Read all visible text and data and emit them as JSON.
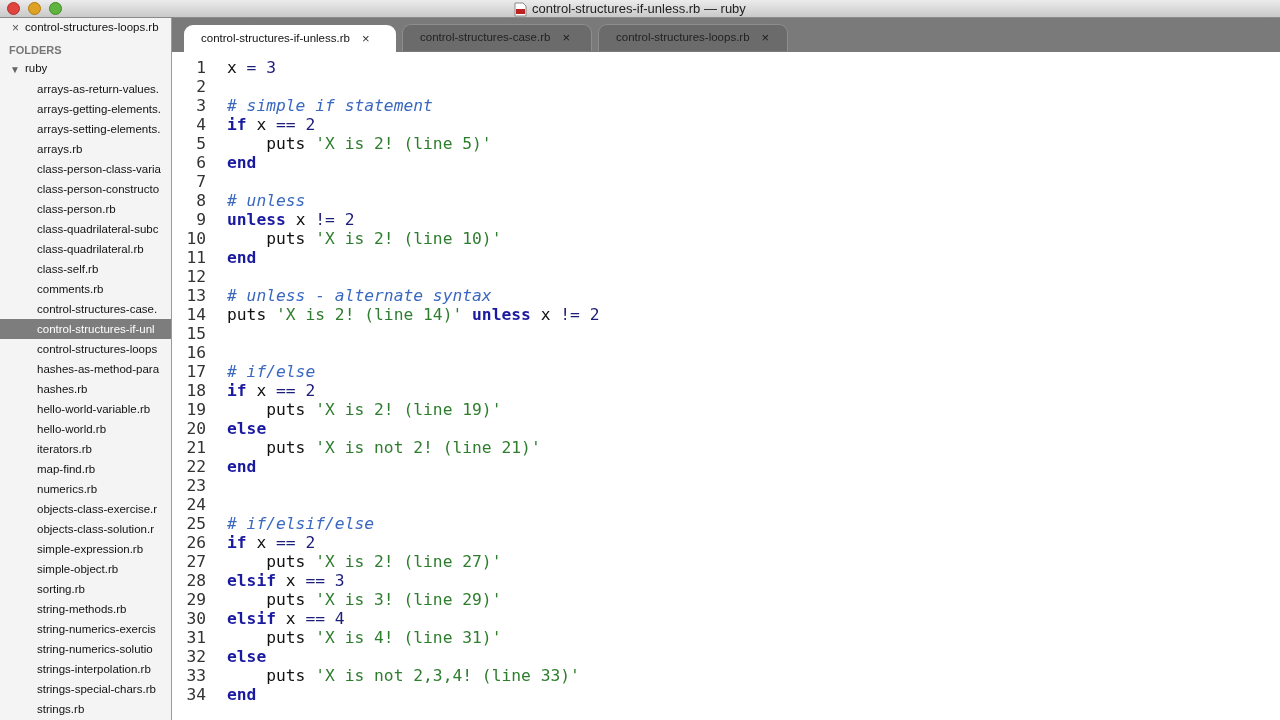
{
  "window": {
    "title": "control-structures-if-unless.rb — ruby"
  },
  "sidebar": {
    "open_files": [
      {
        "name": "control-structures-loops.rb",
        "close": "×"
      }
    ],
    "folders_heading": "FOLDERS",
    "folder": {
      "toggle": "▼",
      "name": "ruby",
      "expanded": true,
      "children": [
        {
          "name": "arrays-as-return-values.",
          "selected": false
        },
        {
          "name": "arrays-getting-elements.",
          "selected": false
        },
        {
          "name": "arrays-setting-elements.",
          "selected": false
        },
        {
          "name": "arrays.rb",
          "selected": false
        },
        {
          "name": "class-person-class-varia",
          "selected": false
        },
        {
          "name": "class-person-constructo",
          "selected": false
        },
        {
          "name": "class-person.rb",
          "selected": false
        },
        {
          "name": "class-quadrilateral-subc",
          "selected": false
        },
        {
          "name": "class-quadrilateral.rb",
          "selected": false
        },
        {
          "name": "class-self.rb",
          "selected": false
        },
        {
          "name": "comments.rb",
          "selected": false
        },
        {
          "name": "control-structures-case.",
          "selected": false
        },
        {
          "name": "control-structures-if-unl",
          "selected": true
        },
        {
          "name": "control-structures-loops",
          "selected": false
        },
        {
          "name": "hashes-as-method-para",
          "selected": false
        },
        {
          "name": "hashes.rb",
          "selected": false
        },
        {
          "name": "hello-world-variable.rb",
          "selected": false
        },
        {
          "name": "hello-world.rb",
          "selected": false
        },
        {
          "name": "iterators.rb",
          "selected": false
        },
        {
          "name": "map-find.rb",
          "selected": false
        },
        {
          "name": "numerics.rb",
          "selected": false
        },
        {
          "name": "objects-class-exercise.r",
          "selected": false
        },
        {
          "name": "objects-class-solution.r",
          "selected": false
        },
        {
          "name": "simple-expression.rb",
          "selected": false
        },
        {
          "name": "simple-object.rb",
          "selected": false
        },
        {
          "name": "sorting.rb",
          "selected": false
        },
        {
          "name": "string-methods.rb",
          "selected": false
        },
        {
          "name": "string-numerics-exercis",
          "selected": false
        },
        {
          "name": "string-numerics-solutio",
          "selected": false
        },
        {
          "name": "strings-interpolation.rb",
          "selected": false
        },
        {
          "name": "strings-special-chars.rb",
          "selected": false
        },
        {
          "name": "strings.rb",
          "selected": false
        }
      ]
    }
  },
  "tabs": [
    {
      "label": "control-structures-if-unless.rb",
      "close": "×",
      "selected": true
    },
    {
      "label": "control-structures-case.rb",
      "close": "×",
      "selected": false
    },
    {
      "label": "control-structures-loops.rb",
      "close": "×",
      "selected": false
    }
  ],
  "editor": {
    "lines": [
      {
        "number": "1",
        "tokens": [
          {
            "kind": "plain",
            "text": "x "
          },
          {
            "kind": "op",
            "text": "= 3"
          }
        ]
      },
      {
        "number": "2"
      },
      {
        "number": "3",
        "tokens": [
          {
            "kind": "comment",
            "text": "# simple if statement"
          }
        ]
      },
      {
        "number": "4",
        "tokens": [
          {
            "kind": "keyword",
            "text": "if"
          },
          {
            "kind": "plain",
            "text": " x "
          },
          {
            "kind": "op",
            "text": "== 2"
          }
        ]
      },
      {
        "number": "5",
        "tokens": [
          {
            "kind": "plain",
            "text": "    puts "
          },
          {
            "kind": "string",
            "text": "'X is 2! (line 5)'"
          }
        ]
      },
      {
        "number": "6",
        "tokens": [
          {
            "kind": "keyword",
            "text": "end"
          }
        ]
      },
      {
        "number": "7"
      },
      {
        "number": "8",
        "tokens": [
          {
            "kind": "comment",
            "text": "# unless"
          }
        ]
      },
      {
        "number": "9",
        "tokens": [
          {
            "kind": "keyword",
            "text": "unless"
          },
          {
            "kind": "plain",
            "text": " x "
          },
          {
            "kind": "op",
            "text": "!= 2"
          }
        ]
      },
      {
        "number": "10",
        "tokens": [
          {
            "kind": "plain",
            "text": "    puts "
          },
          {
            "kind": "string",
            "text": "'X is 2! (line 10)'"
          }
        ]
      },
      {
        "number": "11",
        "tokens": [
          {
            "kind": "keyword",
            "text": "end"
          }
        ]
      },
      {
        "number": "12"
      },
      {
        "number": "13",
        "tokens": [
          {
            "kind": "comment",
            "text": "# unless - alternate syntax"
          }
        ]
      },
      {
        "number": "14",
        "tokens": [
          {
            "kind": "plain",
            "text": "puts "
          },
          {
            "kind": "string",
            "text": "'X is 2! (line 14)'"
          },
          {
            "kind": "keyword",
            "text": " unless"
          },
          {
            "kind": "plain",
            "text": " x "
          },
          {
            "kind": "op",
            "text": "!= 2"
          }
        ]
      },
      {
        "number": "15"
      },
      {
        "number": "16"
      },
      {
        "number": "17",
        "tokens": [
          {
            "kind": "comment",
            "text": "# if/else"
          }
        ]
      },
      {
        "number": "18",
        "tokens": [
          {
            "kind": "keyword",
            "text": "if"
          },
          {
            "kind": "plain",
            "text": " x "
          },
          {
            "kind": "op",
            "text": "== 2"
          }
        ]
      },
      {
        "number": "19",
        "tokens": [
          {
            "kind": "plain",
            "text": "    puts "
          },
          {
            "kind": "string",
            "text": "'X is 2! (line 19)'"
          }
        ]
      },
      {
        "number": "20",
        "tokens": [
          {
            "kind": "keyword",
            "text": "else"
          }
        ]
      },
      {
        "number": "21",
        "tokens": [
          {
            "kind": "plain",
            "text": "    puts "
          },
          {
            "kind": "string",
            "text": "'X is not 2! (line 21)'"
          }
        ]
      },
      {
        "number": "22",
        "tokens": [
          {
            "kind": "keyword",
            "text": "end"
          }
        ]
      },
      {
        "number": "23"
      },
      {
        "number": "24"
      },
      {
        "number": "25",
        "tokens": [
          {
            "kind": "comment",
            "text": "# if/elsif/else"
          }
        ]
      },
      {
        "number": "26",
        "tokens": [
          {
            "kind": "keyword",
            "text": "if"
          },
          {
            "kind": "plain",
            "text": " x "
          },
          {
            "kind": "op",
            "text": "== 2"
          }
        ]
      },
      {
        "number": "27",
        "tokens": [
          {
            "kind": "plain",
            "text": "    puts "
          },
          {
            "kind": "string",
            "text": "'X is 2! (line 27)'"
          }
        ]
      },
      {
        "number": "28",
        "tokens": [
          {
            "kind": "keyword",
            "text": "elsif"
          },
          {
            "kind": "plain",
            "text": " x "
          },
          {
            "kind": "op",
            "text": "== 3"
          }
        ]
      },
      {
        "number": "29",
        "tokens": [
          {
            "kind": "plain",
            "text": "    puts "
          },
          {
            "kind": "string",
            "text": "'X is 3! (line 29)'"
          }
        ]
      },
      {
        "number": "30",
        "tokens": [
          {
            "kind": "keyword",
            "text": "elsif"
          },
          {
            "kind": "plain",
            "text": " x "
          },
          {
            "kind": "op",
            "text": "== 4"
          }
        ]
      },
      {
        "number": "31",
        "tokens": [
          {
            "kind": "plain",
            "text": "    puts "
          },
          {
            "kind": "string",
            "text": "'X is 4! (line 31)'"
          }
        ]
      },
      {
        "number": "32",
        "tokens": [
          {
            "kind": "keyword",
            "text": "else"
          }
        ]
      },
      {
        "number": "33",
        "tokens": [
          {
            "kind": "plain",
            "text": "    puts "
          },
          {
            "kind": "string",
            "text": "'X is not 2,3,4! (line 33)'"
          }
        ]
      },
      {
        "number": "34",
        "tokens": [
          {
            "kind": "keyword",
            "text": "end"
          }
        ]
      }
    ]
  }
}
